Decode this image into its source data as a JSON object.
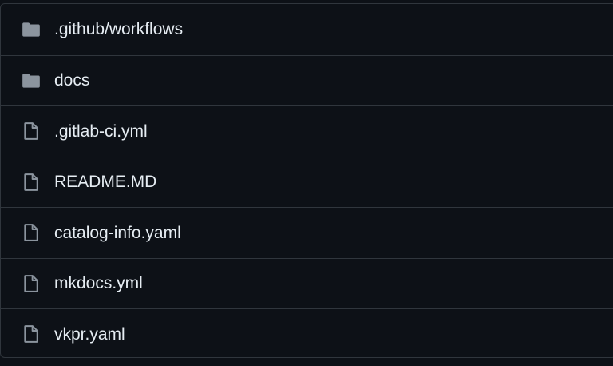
{
  "files": [
    {
      "name": ".github/workflows",
      "icon": "folder-icon"
    },
    {
      "name": "docs",
      "icon": "folder-icon"
    },
    {
      "name": ".gitlab-ci.yml",
      "icon": "file-icon"
    },
    {
      "name": "README.MD",
      "icon": "file-icon"
    },
    {
      "name": "catalog-info.yaml",
      "icon": "file-icon"
    },
    {
      "name": "mkdocs.yml",
      "icon": "file-icon"
    },
    {
      "name": "vkpr.yaml",
      "icon": "file-icon"
    }
  ],
  "colors": {
    "background": "#0d1117",
    "border": "#30363d",
    "text": "#e6edf3",
    "icon": "#8b949e"
  }
}
